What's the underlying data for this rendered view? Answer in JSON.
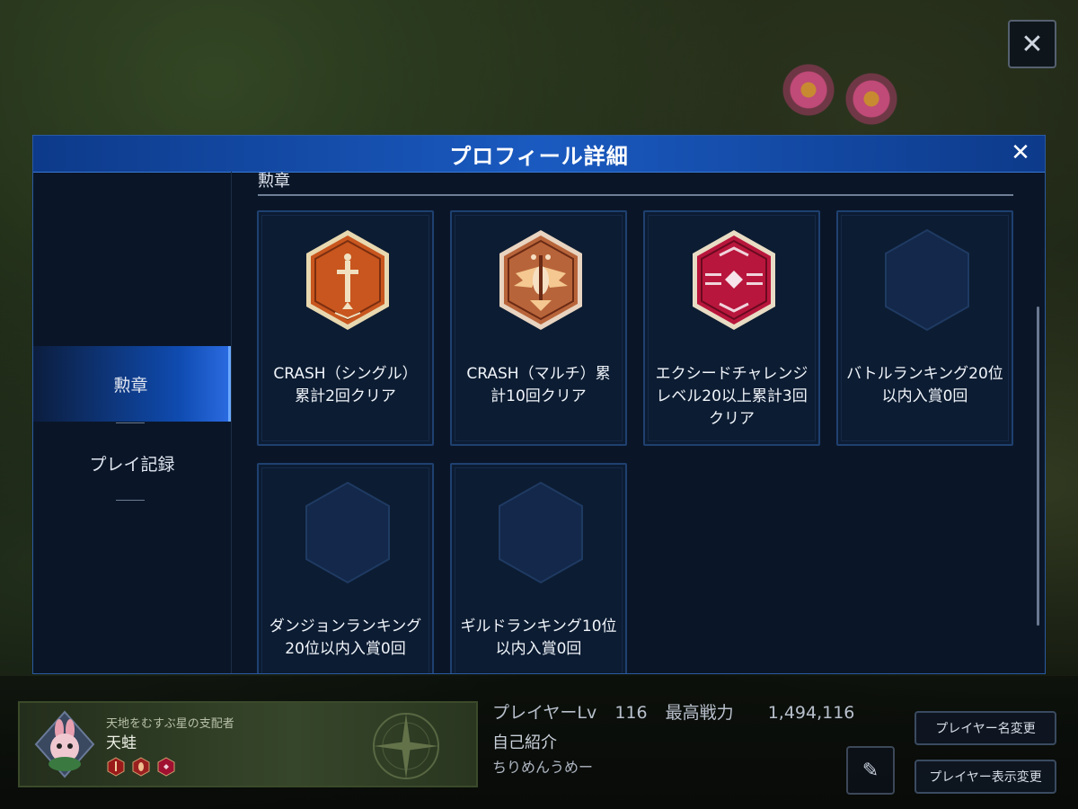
{
  "modal": {
    "title": "プロフィール詳細",
    "close_glyph": "✕"
  },
  "top_close_glyph": "✕",
  "sidebar": {
    "items": [
      {
        "label": "勲章",
        "active": true
      },
      {
        "label": "プレイ記録",
        "active": false
      }
    ]
  },
  "section": {
    "label": "勲章"
  },
  "badges": [
    {
      "label": "CRASH（シングル）累計2回クリア",
      "icon": "sword-medal-icon",
      "obtained": true,
      "color": "#c8561e"
    },
    {
      "label": "CRASH（マルチ）累計10回クリア",
      "icon": "winged-medal-icon",
      "obtained": true,
      "color": "#b8643a"
    },
    {
      "label": "エクシードチャレンジレベル20以上累計3回クリア",
      "icon": "diamond-medal-icon",
      "obtained": true,
      "color": "#b8163c"
    },
    {
      "label": "バトルランキング20位以内入賞0回",
      "icon": "empty-hexagon-icon",
      "obtained": false,
      "color": "#13284a"
    },
    {
      "label": "ダンジョンランキング20位以内入賞0回",
      "icon": "empty-hexagon-icon",
      "obtained": false,
      "color": "#13284a"
    },
    {
      "label": "ギルドランキング10位以内入賞0回",
      "icon": "empty-hexagon-icon",
      "obtained": false,
      "color": "#13284a"
    }
  ],
  "player": {
    "title": "天地をむすぶ星の支配者",
    "name": "天蛙",
    "level_label": "プレイヤーLv",
    "level": "116",
    "power_label": "最高戦力",
    "power": "1,494,116",
    "self_intro_label": "自己紹介",
    "self_intro": "ちりめんうめー"
  },
  "buttons": {
    "rename": "プレイヤー名変更",
    "display_change": "プレイヤー表示変更",
    "edit_glyph": "✎"
  }
}
